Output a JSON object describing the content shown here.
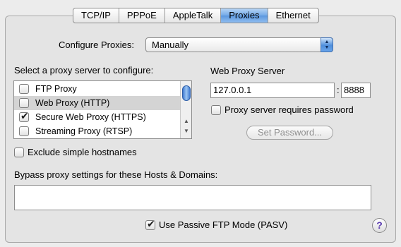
{
  "tabs": [
    "TCP/IP",
    "PPPoE",
    "AppleTalk",
    "Proxies",
    "Ethernet"
  ],
  "active_tab": "Proxies",
  "configure": {
    "label": "Configure Proxies:",
    "value": "Manually"
  },
  "proxy_list": {
    "heading": "Select a proxy server to configure:",
    "items": [
      {
        "label": "FTP Proxy",
        "checked": false,
        "selected": false
      },
      {
        "label": "Web Proxy (HTTP)",
        "checked": false,
        "selected": true
      },
      {
        "label": "Secure Web Proxy (HTTPS)",
        "checked": true,
        "selected": false
      },
      {
        "label": "Streaming Proxy (RTSP)",
        "checked": false,
        "selected": false
      }
    ]
  },
  "server": {
    "heading": "Web Proxy Server",
    "host": "127.0.0.1",
    "separator": ":",
    "port": "8888",
    "password_label": "Proxy server requires password",
    "password_checked": false,
    "set_password_label": "Set Password..."
  },
  "exclude": {
    "label": "Exclude simple hostnames",
    "checked": false
  },
  "bypass": {
    "label": "Bypass proxy settings for these Hosts & Domains:",
    "value": ""
  },
  "passive": {
    "label": "Use Passive FTP Mode (PASV)",
    "checked": true
  },
  "help_label": "?"
}
